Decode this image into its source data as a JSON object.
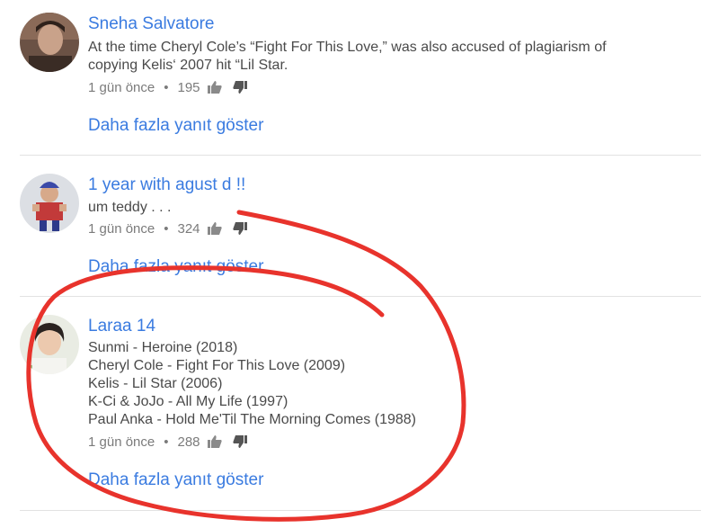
{
  "comments": [
    {
      "author": "Sneha Salvatore",
      "lines": [
        "At the time Cheryl Cole’s “Fight For This Love,” was also accused of plagiarism of",
        "copying Kelis‘ 2007 hit “Lil Star."
      ],
      "time": "1 gün önce",
      "likes": "195",
      "more_label": "Daha fazla yanıt göster"
    },
    {
      "author": "1 year with agust d !!",
      "lines": [
        "um teddy . . ."
      ],
      "time": "1 gün önce",
      "likes": "324",
      "more_label": "Daha fazla yanıt göster"
    },
    {
      "author": "Laraa 14",
      "lines": [
        "Sunmi - Heroine (2018)",
        "Cheryl Cole - Fight For This Love (2009)",
        "Kelis - Lil Star (2006)",
        "K-Ci & JoJo - All My Life (1997)",
        "Paul Anka - Hold Me'Til The Morning Comes (1988)"
      ],
      "time": "1 gün önce",
      "likes": "288",
      "more_label": "Daha fazla yanıt göster"
    }
  ],
  "meta_separator": "•",
  "colors": {
    "author": "#3a7be0",
    "link": "#3a7be0",
    "annotation": "#e8332c"
  },
  "icons": {
    "like": "thumbs-up-icon",
    "dislike": "thumbs-down-icon"
  }
}
